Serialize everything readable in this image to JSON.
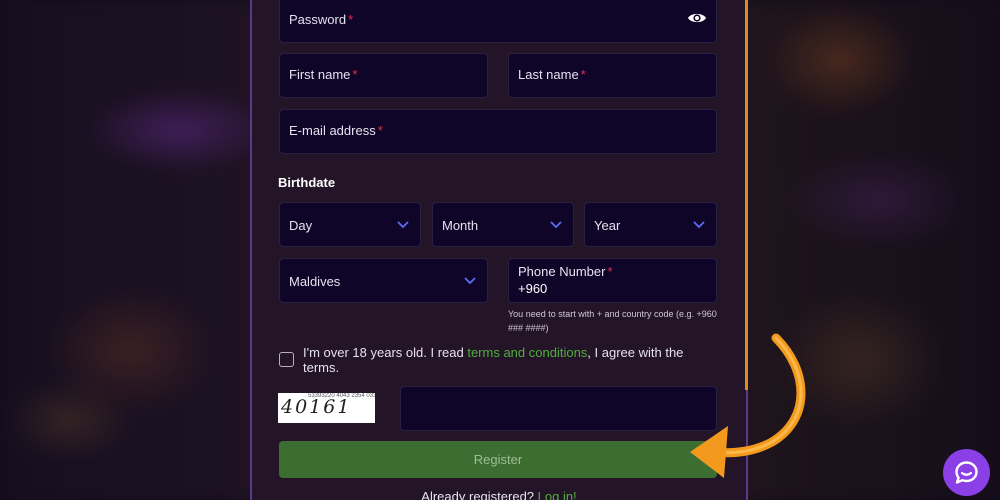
{
  "form": {
    "password_label": "Password",
    "first_name_label": "First name",
    "last_name_label": "Last name",
    "email_label": "E-mail address",
    "required_mark": "*",
    "birthdate_title": "Birthdate",
    "day_label": "Day",
    "month_label": "Month",
    "year_label": "Year",
    "country_value": "Maldives",
    "phone_label": "Phone Number",
    "phone_value": "+960",
    "phone_hint": "You need to start with + and country code (e.g. +960 ### ####)",
    "consent_prefix": "I'm over 18 years old. I read ",
    "consent_link": "terms and conditions",
    "consent_suffix": ", I agree with the terms.",
    "captcha_code": "40161",
    "captcha_noise": "53393220 4043 2354 03320 / Vaoob9",
    "captcha_value": "",
    "register_label": "Register",
    "login_prefix": "Already registered? ",
    "login_link": "Log in!"
  },
  "icons": {
    "password_toggle": "eye-icon",
    "select_chevron": "chevron-down-icon",
    "chat": "chat-bubble-icon",
    "annotation": "curved-arrow-icon"
  },
  "colors": {
    "field_bg": "#0f0529",
    "modal_bg": "#231428",
    "modal_border": "#5a3a8c",
    "accent_green": "#4fae3c",
    "register_bg": "#3c6e32",
    "required_red": "#e0314b",
    "chevron_blue": "#5b6ef5",
    "arrow_orange": "#f39a1e",
    "chat_purple": "#8b3fe6"
  }
}
